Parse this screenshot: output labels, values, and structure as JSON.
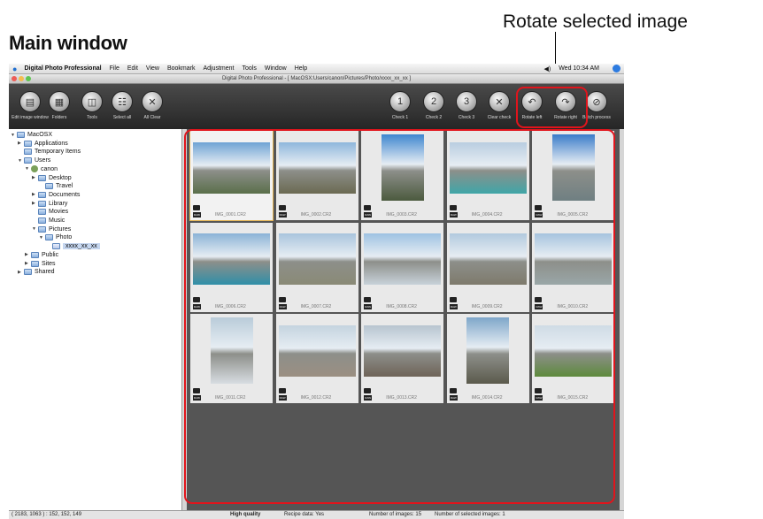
{
  "labels": {
    "heading": "Main window",
    "rotate_callout": "Rotate selected image"
  },
  "menubar": {
    "app": "Digital Photo Professional",
    "items": [
      "File",
      "Edit",
      "View",
      "Bookmark",
      "Adjustment",
      "Tools",
      "Window",
      "Help"
    ],
    "clock": "Wed 10:34 AM",
    "volume": "◀)"
  },
  "window": {
    "title": "Digital Photo Professional - [ MacOSX:Users/canon/Pictures/Photo/xxxx_xx_xx ]"
  },
  "toolbar": {
    "left": [
      {
        "label": "Edit image window",
        "icon": "edit-image-icon",
        "glyph": "▤"
      },
      {
        "label": "Folders",
        "icon": "folders-icon",
        "glyph": "▦"
      },
      {
        "label": "Tools",
        "icon": "tools-icon",
        "glyph": "◫"
      },
      {
        "label": "Select all",
        "icon": "select-all-icon",
        "glyph": "☷"
      },
      {
        "label": "All Clear",
        "icon": "all-clear-icon",
        "glyph": "✕"
      }
    ],
    "right": [
      {
        "label": "Check 1",
        "icon": "check1-icon",
        "glyph": "1"
      },
      {
        "label": "Check 2",
        "icon": "check2-icon",
        "glyph": "2"
      },
      {
        "label": "Check 3",
        "icon": "check3-icon",
        "glyph": "3"
      },
      {
        "label": "Clear check",
        "icon": "clear-check-icon",
        "glyph": "✕"
      },
      {
        "label": "Rotate left",
        "icon": "rotate-left-icon",
        "glyph": "↶"
      },
      {
        "label": "Rotate right",
        "icon": "rotate-right-icon",
        "glyph": "↷"
      },
      {
        "label": "Batch process",
        "icon": "batch-process-icon",
        "glyph": "⊘"
      }
    ]
  },
  "tree": [
    {
      "label": "MacOSX",
      "depth": 0,
      "tri": "▼",
      "type": "drive"
    },
    {
      "label": "Applications",
      "depth": 1,
      "tri": "▶",
      "type": "folder"
    },
    {
      "label": "Temporary Items",
      "depth": 1,
      "tri": "",
      "type": "folder"
    },
    {
      "label": "Users",
      "depth": 1,
      "tri": "▼",
      "type": "folder"
    },
    {
      "label": "canon",
      "depth": 2,
      "tri": "▼",
      "type": "user"
    },
    {
      "label": "Desktop",
      "depth": 3,
      "tri": "▶",
      "type": "folder"
    },
    {
      "label": "Travel",
      "depth": 4,
      "tri": "",
      "type": "folder"
    },
    {
      "label": "Documents",
      "depth": 3,
      "tri": "▶",
      "type": "folder"
    },
    {
      "label": "Library",
      "depth": 3,
      "tri": "▶",
      "type": "folder"
    },
    {
      "label": "Movies",
      "depth": 3,
      "tri": "",
      "type": "folder"
    },
    {
      "label": "Music",
      "depth": 3,
      "tri": "",
      "type": "folder"
    },
    {
      "label": "Pictures",
      "depth": 3,
      "tri": "▼",
      "type": "folder"
    },
    {
      "label": "Photo",
      "depth": 4,
      "tri": "▼",
      "type": "folder"
    },
    {
      "label": "xxxx_xx_xx",
      "depth": 5,
      "tri": "",
      "type": "selected"
    },
    {
      "label": "Public",
      "depth": 2,
      "tri": "▶",
      "type": "folder"
    },
    {
      "label": "Sites",
      "depth": 2,
      "tri": "▶",
      "type": "folder"
    },
    {
      "label": "Shared",
      "depth": 1,
      "tri": "▶",
      "type": "folder"
    }
  ],
  "images": [
    {
      "name": "IMG_0001.CR2",
      "orient": "landscape",
      "sky": "#6ea3d4",
      "land": "#5a6f4a",
      "selected": true
    },
    {
      "name": "IMG_0002.CR2",
      "orient": "landscape",
      "sky": "#8fb7dc",
      "land": "#6b6a52",
      "selected": false
    },
    {
      "name": "IMG_0003.CR2",
      "orient": "portrait",
      "sky": "#3e86cf",
      "land": "#4b5a3e",
      "selected": false
    },
    {
      "name": "IMG_0004.CR2",
      "orient": "landscape",
      "sky": "#b9cde0",
      "land": "#3fa6a8",
      "selected": false
    },
    {
      "name": "IMG_0005.CR2",
      "orient": "portrait",
      "sky": "#3a7cc9",
      "land": "#6f7f82",
      "selected": false
    },
    {
      "name": "IMG_0006.CR2",
      "orient": "landscape",
      "sky": "#8bb3d6",
      "land": "#2f8fa8",
      "selected": false
    },
    {
      "name": "IMG_0007.CR2",
      "orient": "landscape",
      "sky": "#a9c4dd",
      "land": "#8a8a76",
      "selected": false
    },
    {
      "name": "IMG_0008.CR2",
      "orient": "landscape",
      "sky": "#9ec2e2",
      "land": "#c8d2da",
      "selected": false
    },
    {
      "name": "IMG_0009.CR2",
      "orient": "landscape",
      "sky": "#b2c9de",
      "land": "#7e7a6c",
      "selected": false
    },
    {
      "name": "IMG_0010.CR2",
      "orient": "landscape",
      "sky": "#a6c3de",
      "land": "#9aa7a8",
      "selected": false
    },
    {
      "name": "IMG_0011.CR2",
      "orient": "portrait",
      "sky": "#b9cbd9",
      "land": "#d8dde2",
      "selected": false
    },
    {
      "name": "IMG_0012.CR2",
      "orient": "landscape",
      "sky": "#c4d3df",
      "land": "#9b8f82",
      "selected": false
    },
    {
      "name": "IMG_0013.CR2",
      "orient": "landscape",
      "sky": "#b7c4cf",
      "land": "#6e6358",
      "selected": false
    },
    {
      "name": "IMG_0014.CR2",
      "orient": "portrait",
      "sky": "#7ea6c9",
      "land": "#5b5a4c",
      "selected": false
    },
    {
      "name": "IMG_0015.CR2",
      "orient": "landscape",
      "sky": "#cfdbe5",
      "land": "#5d8a3c",
      "selected": false
    }
  ],
  "status": {
    "coords": "( 2183, 1063 ) : 152, 152, 149",
    "quality": "High quality",
    "recipe": "Recipe data: Yes",
    "count": "Number of images: 15",
    "selected": "Number of selected images: 1"
  }
}
